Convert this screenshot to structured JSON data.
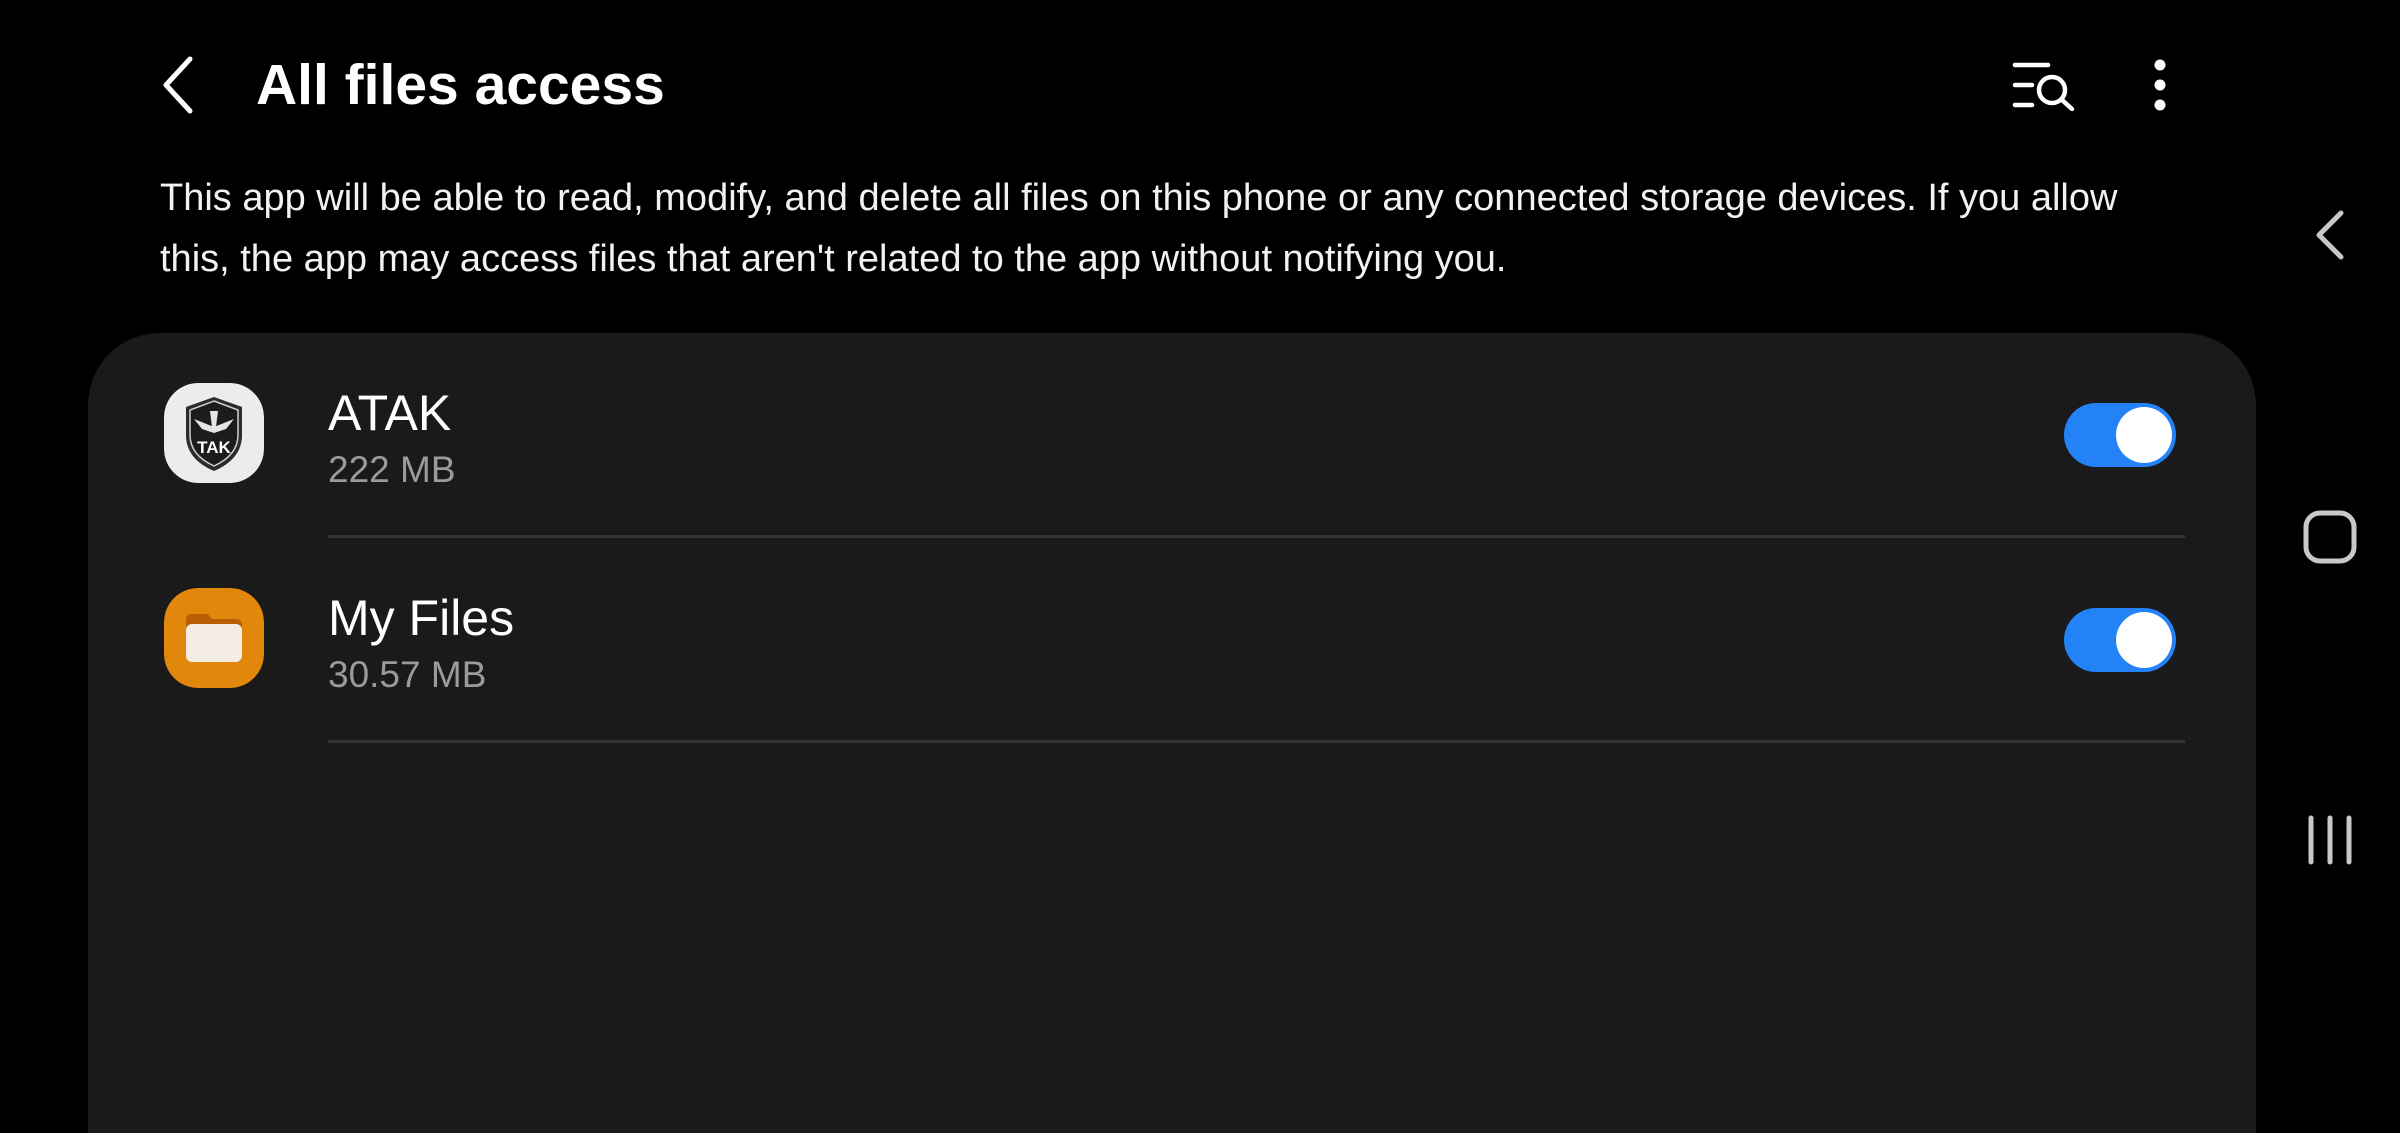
{
  "header": {
    "title": "All files access",
    "back_icon": "back-arrow-icon",
    "search_icon": "search-list-icon",
    "more_icon": "more-options-icon"
  },
  "description": "This app will be able to read, modify, and delete all files on this phone or any connected storage devices. If you allow this, the app may access files that aren't related to the app without notifying you.",
  "apps": [
    {
      "name": "ATAK",
      "size": "222 MB",
      "icon": "atak-app-icon",
      "icon_text": "TAK",
      "enabled": true
    },
    {
      "name": "My Files",
      "size": "30.57 MB",
      "icon": "my-files-app-icon",
      "enabled": true
    }
  ],
  "navbar": {
    "back_icon": "nav-back-icon",
    "home_icon": "nav-home-icon",
    "recents_icon": "nav-recents-icon"
  },
  "colors": {
    "background": "#000000",
    "card": "#1a1a1a",
    "toggle_on": "#2382f6",
    "secondary_text": "#9b9b9b",
    "my_files_orange": "#e0870c"
  }
}
